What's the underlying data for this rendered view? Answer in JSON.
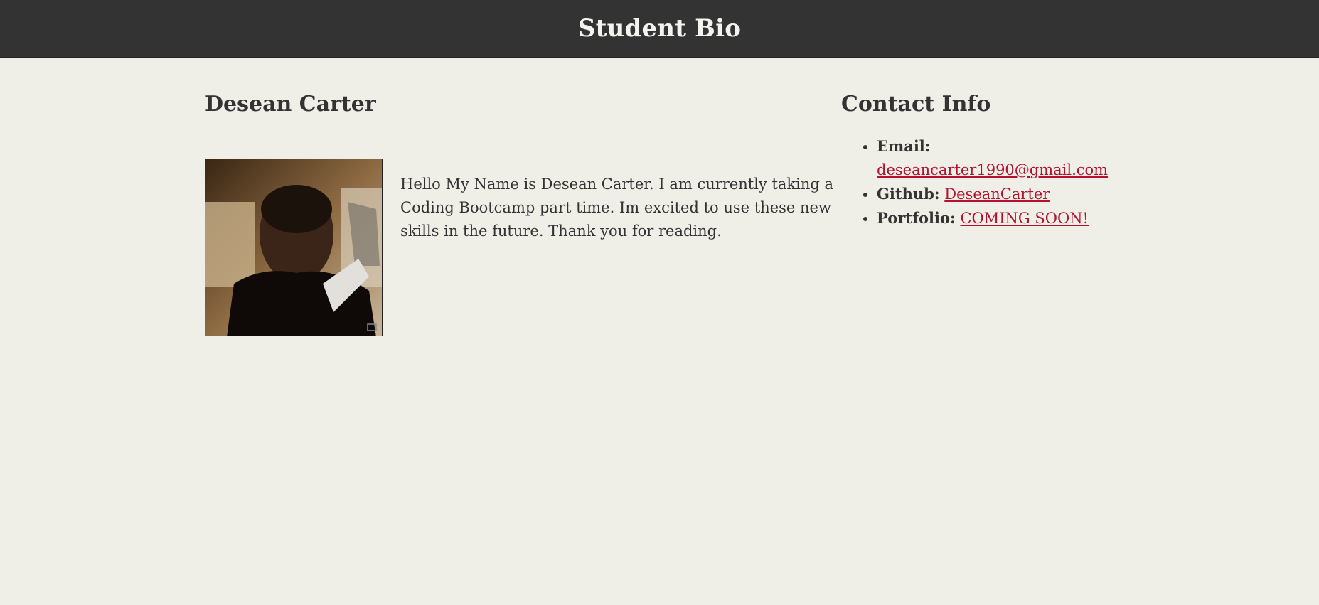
{
  "header": {
    "title": "Student Bio"
  },
  "bio": {
    "name": "Desean Carter",
    "text": "Hello My Name is Desean Carter. I am currently taking a Coding Bootcamp part time. Im excited to use these new skills in the future. Thank you for reading."
  },
  "contact": {
    "title": "Contact Info",
    "items": [
      {
        "label": "Email:",
        "value": "deseancarter1990@gmail.com"
      },
      {
        "label": "Github:",
        "value": "DeseanCarter"
      },
      {
        "label": "Portfolio:",
        "value": "COMING SOON!"
      }
    ]
  },
  "colors": {
    "header_bg": "#333333",
    "page_bg": "#efeee7",
    "link": "#b3132f"
  }
}
